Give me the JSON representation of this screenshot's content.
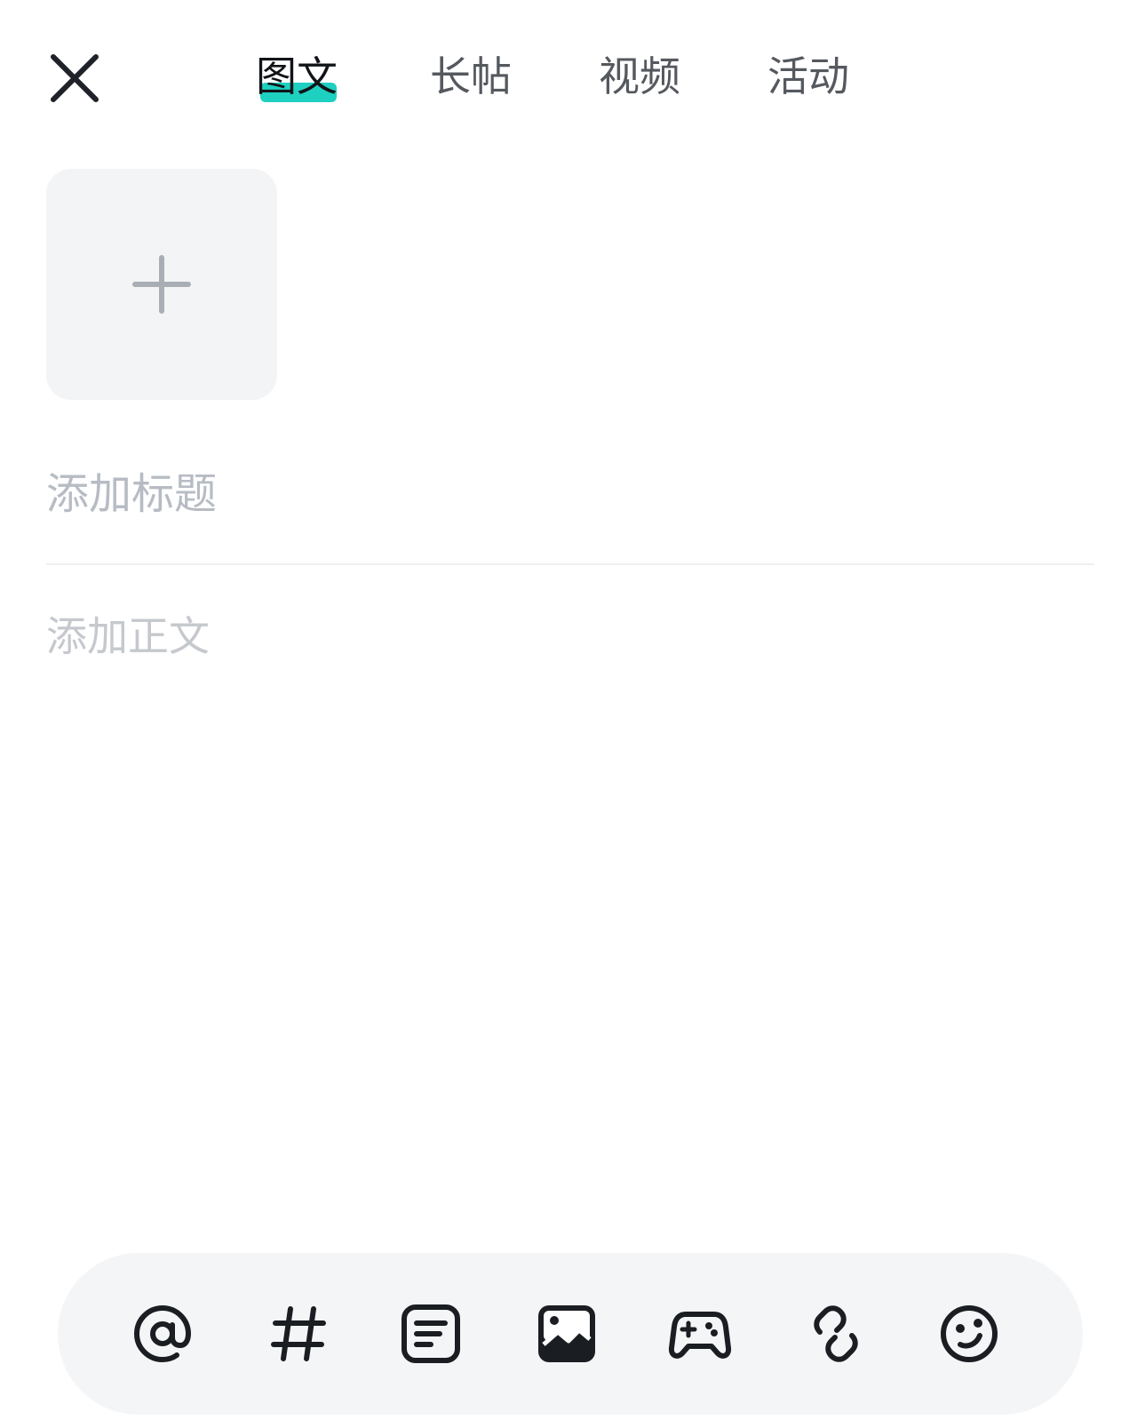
{
  "header": {
    "tabs": [
      {
        "label": "图文",
        "active": true
      },
      {
        "label": "长帖",
        "active": false
      },
      {
        "label": "视频",
        "active": false
      },
      {
        "label": "活动",
        "active": false
      }
    ],
    "accent_color": "#1ed0c0"
  },
  "editor": {
    "title_placeholder": "添加标题",
    "body_placeholder": "添加正文"
  },
  "toolbar": {
    "items": [
      {
        "icon": "at-icon"
      },
      {
        "icon": "hashtag-icon"
      },
      {
        "icon": "text-card-icon"
      },
      {
        "icon": "image-icon"
      },
      {
        "icon": "gamepad-icon"
      },
      {
        "icon": "link-icon"
      },
      {
        "icon": "emoji-icon"
      }
    ]
  }
}
